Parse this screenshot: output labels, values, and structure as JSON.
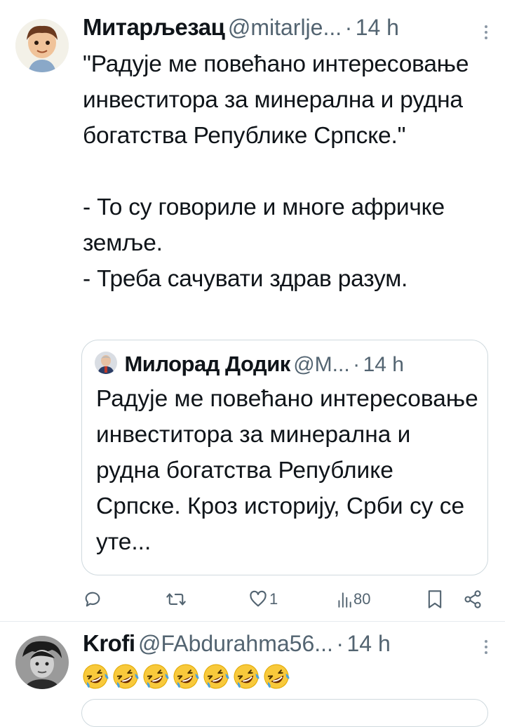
{
  "tweet1": {
    "name": "Митарљезац",
    "handle": "@mitarlje...",
    "dot": "·",
    "time": "14 h",
    "text": "\"Радује ме повећано интересовање инвеститора за минерална и рудна богатства Републике Српске.\"\n\n- То су говориле и многе афричке земље.\n- Треба сачувати здрав разум.",
    "quote": {
      "name": "Милорад Додик",
      "handle": "@M...",
      "dot": "·",
      "time": "14 h",
      "text": "Радује ме повећано интересовање инвеститора за минерална и рудна богатства Републике Српске. Кроз историју, Срби су се уте..."
    },
    "actions": {
      "reply_icon": "reply-icon",
      "retweet_icon": "retweet-icon",
      "like_icon": "heart-icon",
      "like_count": "1",
      "views_icon": "views-icon",
      "views_count": "80",
      "bookmark_icon": "bookmark-icon",
      "share_icon": "share-icon"
    }
  },
  "tweet2": {
    "name": "Krofi",
    "handle": "@FAbdurahma56...",
    "dot": "·",
    "time": "14 h",
    "emoji_icon": "rolling-on-floor-laughing-icon",
    "emoji_count": 7
  },
  "colors": {
    "text": "#0f1419",
    "secondary": "#536471",
    "border": "#cfd9de"
  }
}
